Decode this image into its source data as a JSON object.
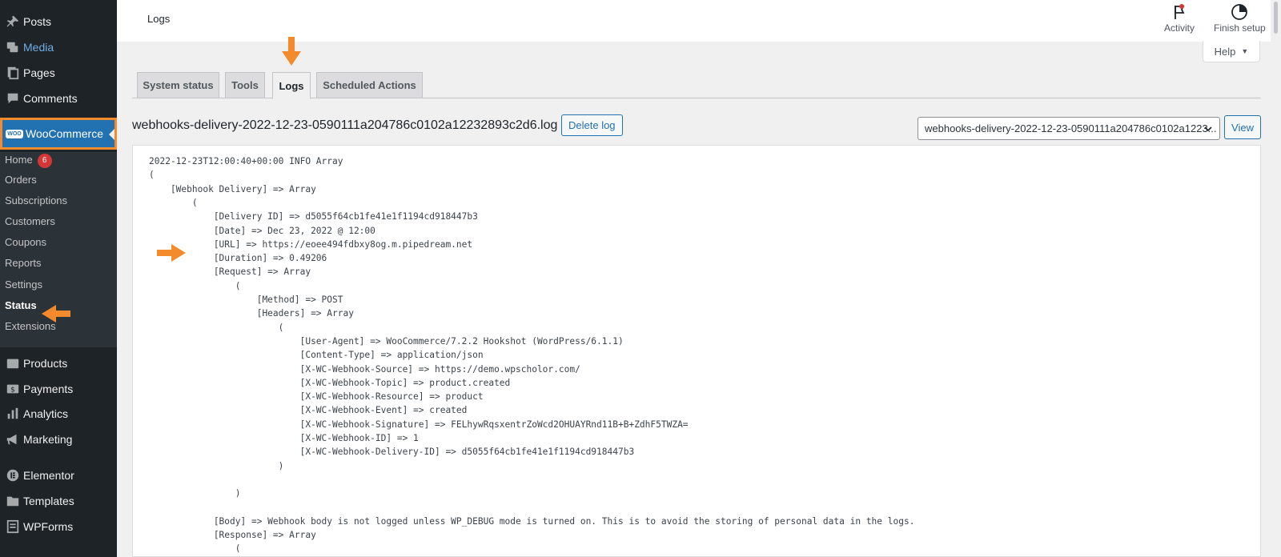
{
  "sidebar": {
    "top_items": [
      {
        "label": "Posts",
        "icon": "pin-icon"
      },
      {
        "label": "Media",
        "icon": "media-icon"
      },
      {
        "label": "Pages",
        "icon": "pages-icon"
      },
      {
        "label": "Comments",
        "icon": "comments-icon"
      }
    ],
    "woocommerce": {
      "label": "WooCommerce",
      "icon_text": "WOO"
    },
    "submenu": [
      {
        "label": "Home"
      },
      {
        "label": "Orders"
      },
      {
        "label": "Subscriptions"
      },
      {
        "label": "Customers"
      },
      {
        "label": "Coupons"
      },
      {
        "label": "Reports"
      },
      {
        "label": "Settings"
      },
      {
        "label": "Status"
      },
      {
        "label": "Extensions"
      }
    ],
    "home_badge": "6",
    "bottom_items": [
      {
        "label": "Products",
        "icon": "products-icon"
      },
      {
        "label": "Payments",
        "icon": "payments-icon"
      },
      {
        "label": "Analytics",
        "icon": "analytics-icon"
      },
      {
        "label": "Marketing",
        "icon": "megaphone-icon"
      },
      {
        "label": "Elementor",
        "icon": "elementor-icon"
      },
      {
        "label": "Templates",
        "icon": "folder-icon"
      },
      {
        "label": "WPForms",
        "icon": "wpforms-icon"
      }
    ]
  },
  "header": {
    "title": "Logs",
    "activity_label": "Activity",
    "finish_setup_label": "Finish setup",
    "help_label": "Help"
  },
  "tabs": [
    {
      "label": "System status"
    },
    {
      "label": "Tools"
    },
    {
      "label": "Logs"
    },
    {
      "label": "Scheduled Actions"
    }
  ],
  "log": {
    "title": "webhooks-delivery-2022-12-23-0590111a204786c0102a12232893c2d6.log",
    "delete_label": "Delete log",
    "select_value": "webhooks-delivery-2022-12-23-0590111a204786c0102a1223...",
    "view_label": "View",
    "lines": [
      "2022-12-23T12:00:40+00:00 INFO Array",
      "(",
      "    [Webhook Delivery] => Array",
      "        (",
      "            [Delivery ID] => d5055f64cb1fe41e1f1194cd918447b3",
      "            [Date] => Dec 23, 2022 @ 12:00",
      "            [URL] => https://eoee494fdbxy8og.m.pipedream.net",
      "            [Duration] => 0.49206",
      "            [Request] => Array",
      "                (",
      "                    [Method] => POST",
      "                    [Headers] => Array",
      "                        (",
      "                            [User-Agent] => WooCommerce/7.2.2 Hookshot (WordPress/6.1.1)",
      "                            [Content-Type] => application/json",
      "                            [X-WC-Webhook-Source] => https://demo.wpscholor.com/",
      "                            [X-WC-Webhook-Topic] => product.created",
      "                            [X-WC-Webhook-Resource] => product",
      "                            [X-WC-Webhook-Event] => created",
      "                            [X-WC-Webhook-Signature] => FELhywRqsxentrZoWcd2OHUAYRnd11B+B+ZdhF5TWZA=",
      "                            [X-WC-Webhook-ID] => 1",
      "                            [X-WC-Webhook-Delivery-ID] => d5055f64cb1fe41e1f1194cd918447b3",
      "                        )",
      "",
      "                )",
      "",
      "            [Body] => Webhook body is not logged unless WP_DEBUG mode is turned on. This is to avoid the storing of personal data in the logs.",
      "            [Response] => Array",
      "                ("
    ]
  },
  "colors": {
    "sidebar_bg": "#1d2327",
    "submenu_bg": "#2c3338",
    "active_blue": "#2271b1",
    "annotation_orange": "#f38b2c",
    "badge_red": "#d63638"
  }
}
